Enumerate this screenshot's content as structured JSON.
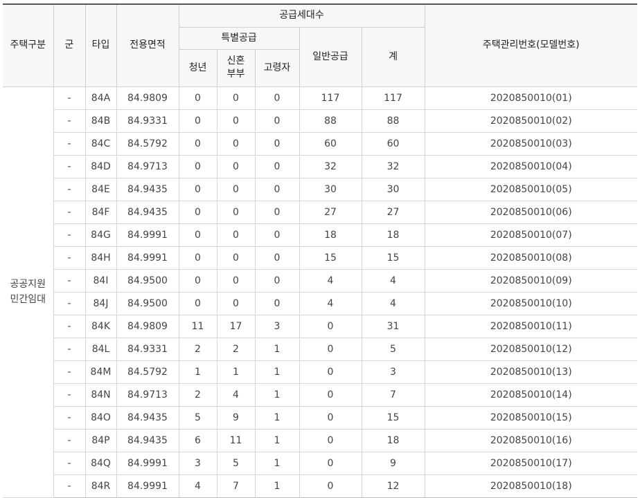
{
  "headers": {
    "housing_type": "주택구분",
    "gun": "군",
    "type": "타입",
    "area": "전용면적",
    "supply_count": "공급세대수",
    "special_supply": "특별공급",
    "youth": "청년",
    "newlywed_line1": "신혼",
    "newlywed_line2": "부부",
    "elderly": "고령자",
    "general_supply": "일반공급",
    "total": "계",
    "housing_mgmt_no": "주택관리번호(모델번호)"
  },
  "group": {
    "line1": "공공지원",
    "line2": "민간임대"
  },
  "rows": [
    {
      "gun": "-",
      "type": "84A",
      "area": "84.9809",
      "youth": "0",
      "newlywed": "0",
      "elderly": "0",
      "general": "117",
      "total": "117",
      "mgmt_no": "2020850010(01)"
    },
    {
      "gun": "-",
      "type": "84B",
      "area": "84.9331",
      "youth": "0",
      "newlywed": "0",
      "elderly": "0",
      "general": "88",
      "total": "88",
      "mgmt_no": "2020850010(02)"
    },
    {
      "gun": "-",
      "type": "84C",
      "area": "84.5792",
      "youth": "0",
      "newlywed": "0",
      "elderly": "0",
      "general": "60",
      "total": "60",
      "mgmt_no": "2020850010(03)"
    },
    {
      "gun": "-",
      "type": "84D",
      "area": "84.9713",
      "youth": "0",
      "newlywed": "0",
      "elderly": "0",
      "general": "32",
      "total": "32",
      "mgmt_no": "2020850010(04)"
    },
    {
      "gun": "-",
      "type": "84E",
      "area": "84.9435",
      "youth": "0",
      "newlywed": "0",
      "elderly": "0",
      "general": "30",
      "total": "30",
      "mgmt_no": "2020850010(05)"
    },
    {
      "gun": "-",
      "type": "84F",
      "area": "84.9435",
      "youth": "0",
      "newlywed": "0",
      "elderly": "0",
      "general": "27",
      "total": "27",
      "mgmt_no": "2020850010(06)"
    },
    {
      "gun": "-",
      "type": "84G",
      "area": "84.9991",
      "youth": "0",
      "newlywed": "0",
      "elderly": "0",
      "general": "18",
      "total": "18",
      "mgmt_no": "2020850010(07)"
    },
    {
      "gun": "-",
      "type": "84H",
      "area": "84.9991",
      "youth": "0",
      "newlywed": "0",
      "elderly": "0",
      "general": "15",
      "total": "15",
      "mgmt_no": "2020850010(08)"
    },
    {
      "gun": "-",
      "type": "84I",
      "area": "84.9500",
      "youth": "0",
      "newlywed": "0",
      "elderly": "0",
      "general": "4",
      "total": "4",
      "mgmt_no": "2020850010(09)"
    },
    {
      "gun": "-",
      "type": "84J",
      "area": "84.9500",
      "youth": "0",
      "newlywed": "0",
      "elderly": "0",
      "general": "4",
      "total": "4",
      "mgmt_no": "2020850010(10)"
    },
    {
      "gun": "-",
      "type": "84K",
      "area": "84.9809",
      "youth": "11",
      "newlywed": "17",
      "elderly": "3",
      "general": "0",
      "total": "31",
      "mgmt_no": "2020850010(11)"
    },
    {
      "gun": "-",
      "type": "84L",
      "area": "84.9331",
      "youth": "2",
      "newlywed": "2",
      "elderly": "1",
      "general": "0",
      "total": "5",
      "mgmt_no": "2020850010(12)"
    },
    {
      "gun": "-",
      "type": "84M",
      "area": "84.5792",
      "youth": "1",
      "newlywed": "1",
      "elderly": "1",
      "general": "0",
      "total": "3",
      "mgmt_no": "2020850010(13)"
    },
    {
      "gun": "-",
      "type": "84N",
      "area": "84.9713",
      "youth": "2",
      "newlywed": "4",
      "elderly": "1",
      "general": "0",
      "total": "7",
      "mgmt_no": "2020850010(14)"
    },
    {
      "gun": "-",
      "type": "84O",
      "area": "84.9435",
      "youth": "5",
      "newlywed": "9",
      "elderly": "1",
      "general": "0",
      "total": "15",
      "mgmt_no": "2020850010(15)"
    },
    {
      "gun": "-",
      "type": "84P",
      "area": "84.9435",
      "youth": "6",
      "newlywed": "11",
      "elderly": "1",
      "general": "0",
      "total": "18",
      "mgmt_no": "2020850010(16)"
    },
    {
      "gun": "-",
      "type": "84Q",
      "area": "84.9991",
      "youth": "3",
      "newlywed": "5",
      "elderly": "1",
      "general": "0",
      "total": "9",
      "mgmt_no": "2020850010(17)"
    },
    {
      "gun": "-",
      "type": "84R",
      "area": "84.9991",
      "youth": "4",
      "newlywed": "7",
      "elderly": "1",
      "general": "0",
      "total": "12",
      "mgmt_no": "2020850010(18)"
    }
  ]
}
